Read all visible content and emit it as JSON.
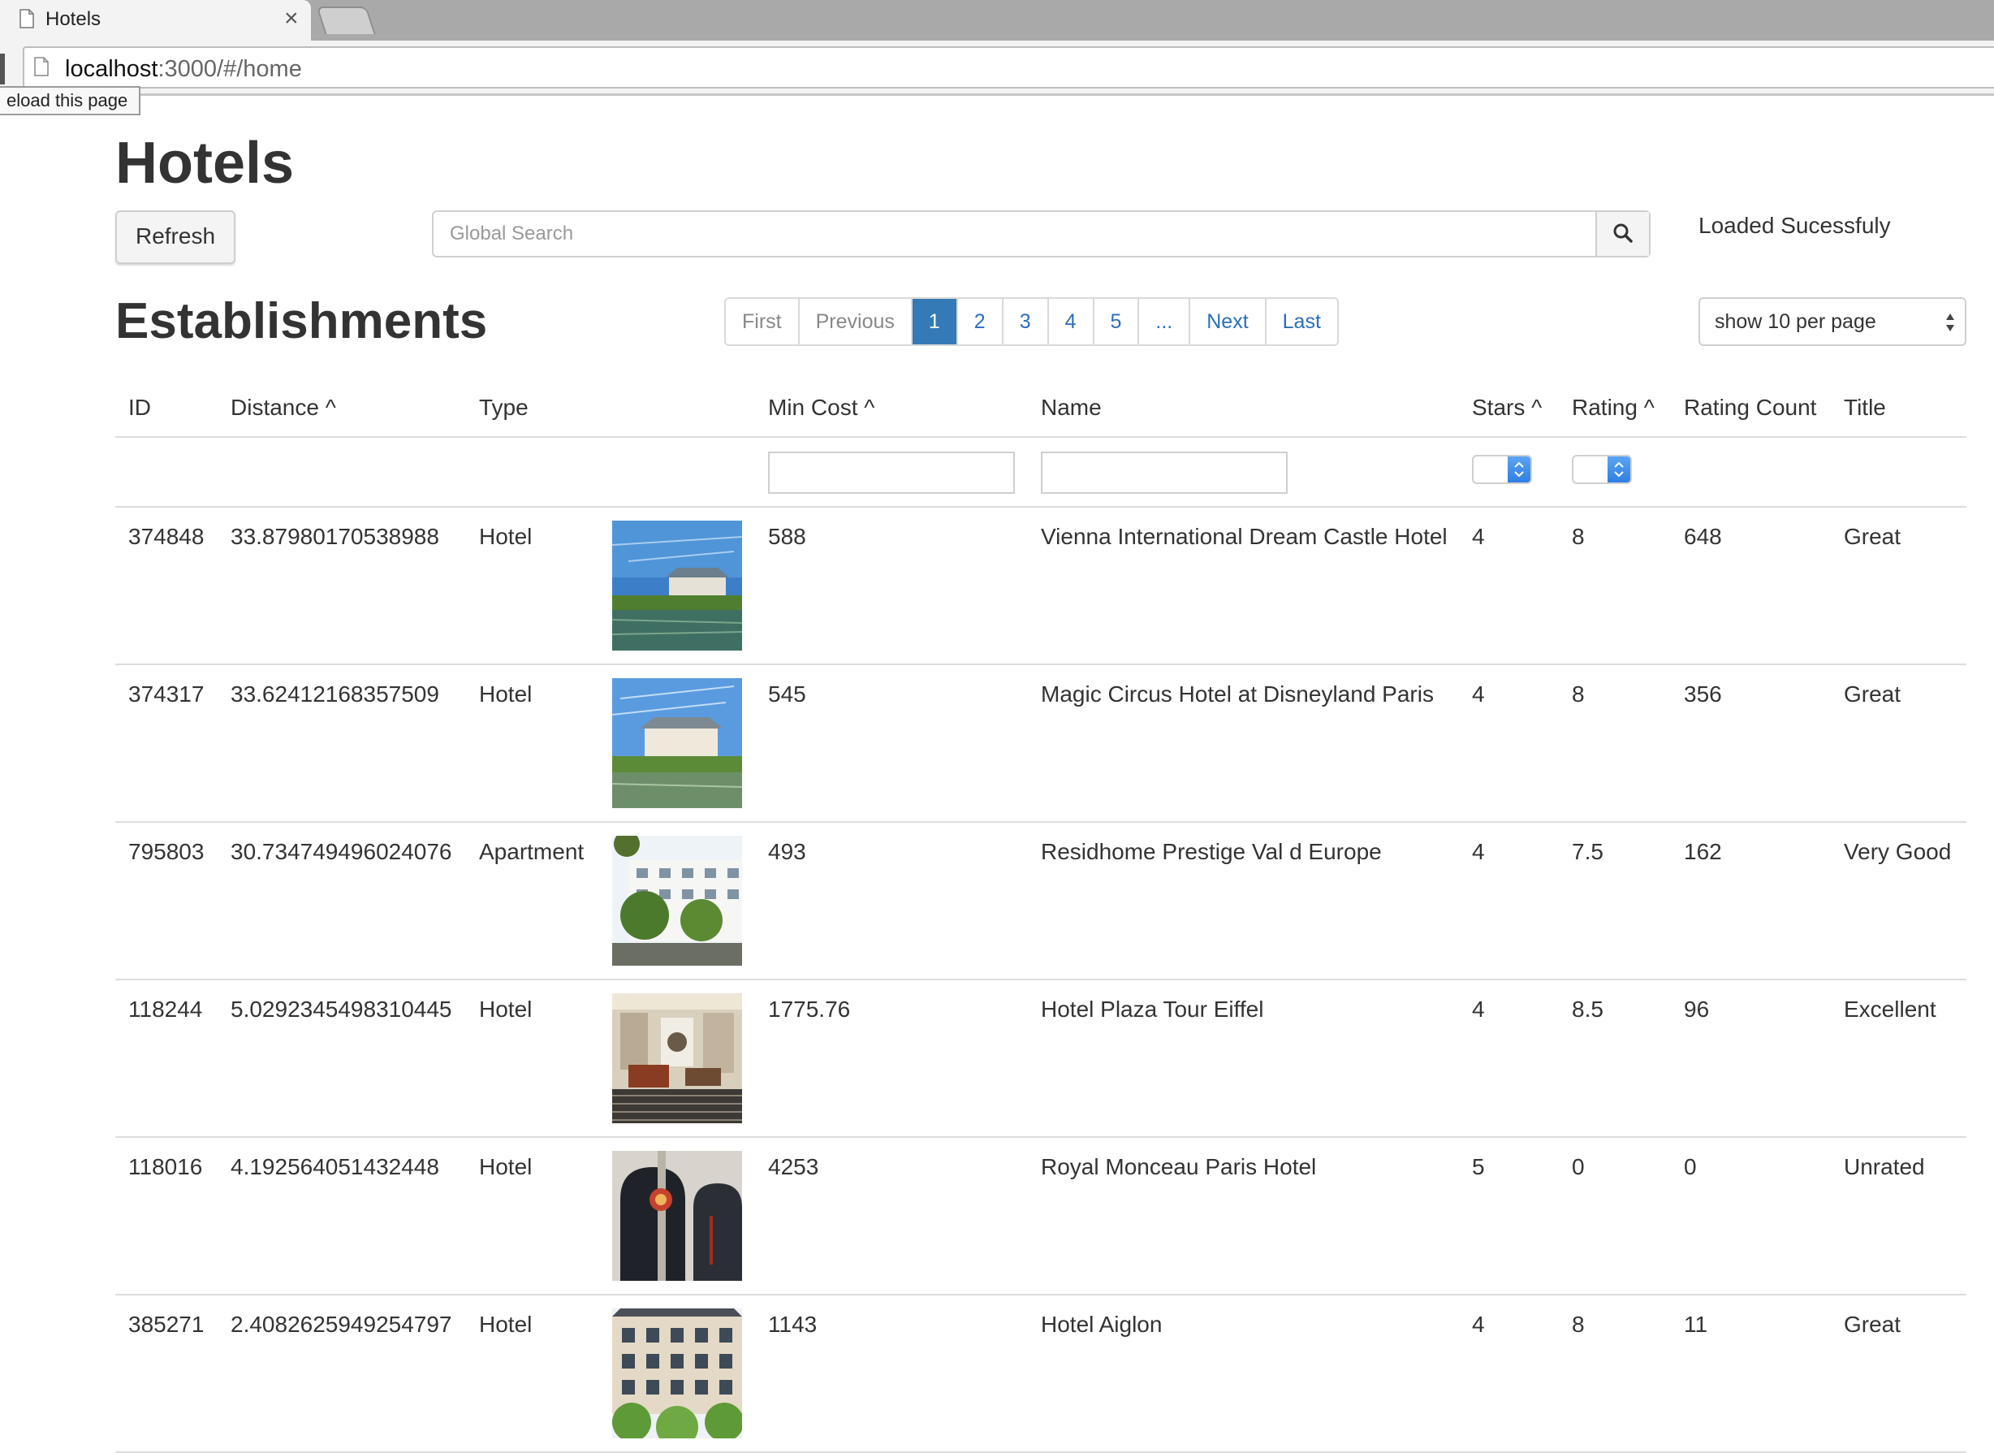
{
  "browser": {
    "tab_title": "Hotels",
    "tab_close": "×",
    "url_host": "localhost",
    "url_rest": ":3000/#/home",
    "tooltip": "eload this page"
  },
  "page": {
    "title": "Hotels",
    "refresh_label": "Refresh",
    "search_placeholder": "Global Search",
    "status": "Loaded Sucessfuly",
    "section_title": "Establishments",
    "per_page": "show 10 per page"
  },
  "pagination": [
    "First",
    "Previous",
    "1",
    "2",
    "3",
    "4",
    "5",
    "...",
    "Next",
    "Last"
  ],
  "pagination_active": "1",
  "table": {
    "headers": {
      "id": "ID",
      "distance": "Distance ^",
      "type": "Type",
      "min_cost": "Min Cost ^",
      "name": "Name",
      "stars": "Stars ^",
      "rating": "Rating ^",
      "rating_count": "Rating Count",
      "title": "Title"
    },
    "rows": [
      {
        "id": "374848",
        "distance": "33.87980170538988",
        "type": "Hotel",
        "min_cost": "588",
        "name": "Vienna International Dream Castle Hotel",
        "stars": "4",
        "rating": "8",
        "rating_count": "648",
        "title": "Great",
        "image": "castle-lake"
      },
      {
        "id": "374317",
        "distance": "33.62412168357509",
        "type": "Hotel",
        "min_cost": "545",
        "name": "Magic Circus Hotel at Disneyland Paris",
        "stars": "4",
        "rating": "8",
        "rating_count": "356",
        "title": "Great",
        "image": "castle-lake"
      },
      {
        "id": "795803",
        "distance": "30.734749496024076",
        "type": "Apartment",
        "min_cost": "493",
        "name": "Residhome Prestige Val d Europe",
        "stars": "4",
        "rating": "7.5",
        "rating_count": "162",
        "title": "Very Good",
        "image": "apartment-building"
      },
      {
        "id": "118244",
        "distance": "5.0292345498310445",
        "type": "Hotel",
        "min_cost": "1775.76",
        "name": "Hotel Plaza Tour Eiffel",
        "stars": "4",
        "rating": "8.5",
        "rating_count": "96",
        "title": "Excellent",
        "image": "lobby-interior"
      },
      {
        "id": "118016",
        "distance": "4.192564051432448",
        "type": "Hotel",
        "min_cost": "4253",
        "name": "Royal Monceau Paris Hotel",
        "stars": "5",
        "rating": "0",
        "rating_count": "0",
        "title": "Unrated",
        "image": "entrance-lanterns"
      },
      {
        "id": "385271",
        "distance": "2.4082625949254797",
        "type": "Hotel",
        "min_cost": "1143",
        "name": "Hotel Aiglon",
        "stars": "4",
        "rating": "8",
        "rating_count": "11",
        "title": "Great",
        "image": "facade-trees"
      }
    ]
  },
  "colors": {
    "accent": "#337ab7",
    "link": "#2a6ebb"
  }
}
